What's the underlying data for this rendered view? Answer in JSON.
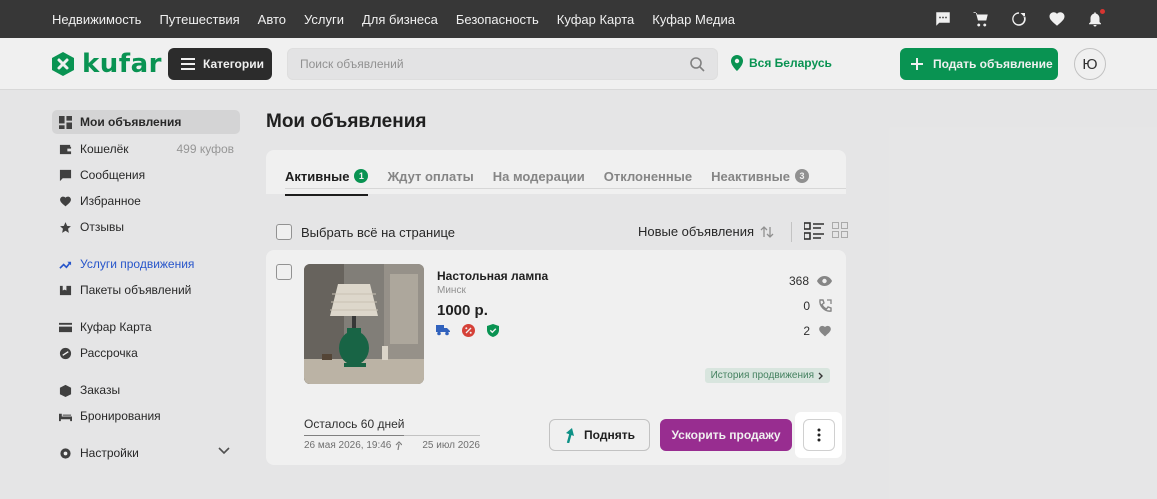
{
  "topnav": {
    "links": [
      "Недвижимость",
      "Путешествия",
      "Авто",
      "Услуги",
      "Для бизнеса",
      "Безопасность",
      "Куфар Карта",
      "Куфар Медиа"
    ],
    "icons": [
      "chat-icon",
      "cart-icon",
      "compare-icon",
      "heart-icon",
      "bell-icon"
    ]
  },
  "header": {
    "logo": "kufar",
    "categories_label": "Категории",
    "search_placeholder": "Поиск объявлений",
    "region": "Вся Беларусь",
    "post_label": "Подать объявление",
    "avatar_letter": "Ю"
  },
  "sidebar": {
    "items": [
      {
        "label": "Мои объявления",
        "icon": "dashboard-icon",
        "active": true
      },
      {
        "label": "Кошелёк",
        "icon": "wallet-icon",
        "count": "499 куфов"
      },
      {
        "label": "Сообщения",
        "icon": "message-icon"
      },
      {
        "label": "Избранное",
        "icon": "heart-icon"
      },
      {
        "label": "Отзывы",
        "icon": "star-icon"
      },
      {
        "label": "Услуги продвижения",
        "icon": "trend-icon",
        "highlight": true
      },
      {
        "label": "Пакеты объявлений",
        "icon": "package-icon"
      },
      {
        "label": "Куфар Карта",
        "icon": "card-icon"
      },
      {
        "label": "Рассрочка",
        "icon": "installment-icon"
      },
      {
        "label": "Заказы",
        "icon": "orders-icon"
      },
      {
        "label": "Бронирования",
        "icon": "booking-icon"
      },
      {
        "label": "Настройки",
        "icon": "settings-icon"
      }
    ]
  },
  "main": {
    "title": "Мои объявления",
    "tabs": [
      {
        "label": "Активные",
        "badge": "1",
        "active": true
      },
      {
        "label": "Ждут оплаты"
      },
      {
        "label": "На модерации"
      },
      {
        "label": "Отклоненные"
      },
      {
        "label": "Неактивные",
        "badge": "3"
      }
    ],
    "select_all_label": "Выбрать всё на странице",
    "sort_label": "Новые объявления"
  },
  "ad": {
    "title": "Настольная лампа",
    "city": "Минск",
    "price": "1000 р.",
    "badges": [
      "delivery-icon",
      "discount-icon",
      "verified-icon"
    ],
    "views": "368",
    "calls": "0",
    "favorites": "2",
    "promo_history_label": "История продвижения",
    "days_left_label": "Осталось 60 дней",
    "days_progress": 0.57,
    "date_start": "26 мая 2026, 19:46",
    "date_end": "25 июл 2026",
    "raise_label": "Поднять",
    "boost_label": "Ускорить продажу"
  },
  "colors": {
    "brand": "#0a9d58",
    "boost": "#a2309a",
    "link_blue": "#2a5bd7",
    "topbar": "#3b3b3b"
  }
}
